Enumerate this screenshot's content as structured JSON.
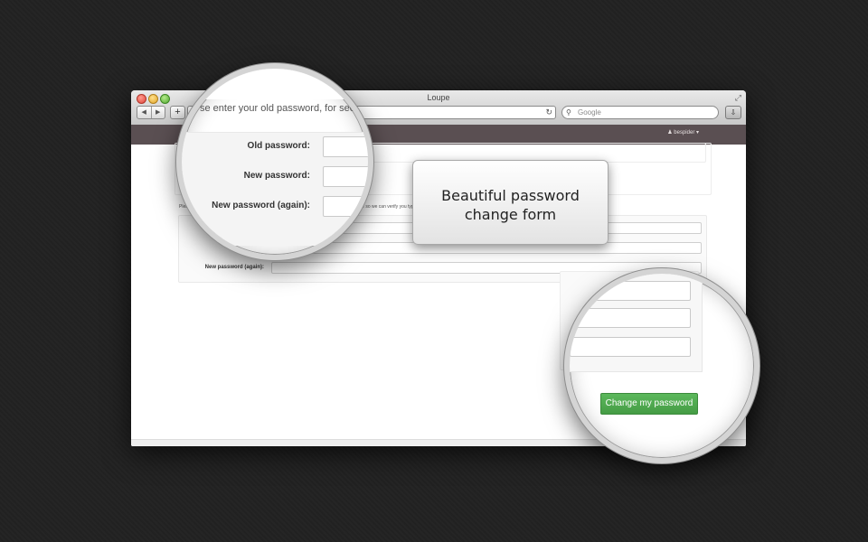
{
  "window": {
    "title": "Loupe",
    "search_placeholder": "Google",
    "user_menu": "bespider ▾"
  },
  "form": {
    "intro_lead": "Please enter your old password, for security's sake, and then enter your new password twice so we can verify you typed it in correctly.",
    "intro_zoom": "se enter your old password, for security's",
    "old_password_label": "Old password:",
    "new_password_label": "New password:",
    "new_password_again_label": "New password (again):",
    "small_label_1": "",
    "small_label_2": "New",
    "small_label_3": "New password (again):",
    "submit_label": "Change my password"
  },
  "callout": {
    "line1": "Beautiful password",
    "line2": "change form"
  },
  "colors": {
    "header": "#5a4f52",
    "button": "#4ea64e",
    "background": "#222222"
  },
  "icons": {
    "back": "◀",
    "forward": "▶",
    "add": "+",
    "reload": "↻",
    "search": "🔍",
    "download": "⇩",
    "fullscreen": "⤢",
    "user": "person"
  }
}
